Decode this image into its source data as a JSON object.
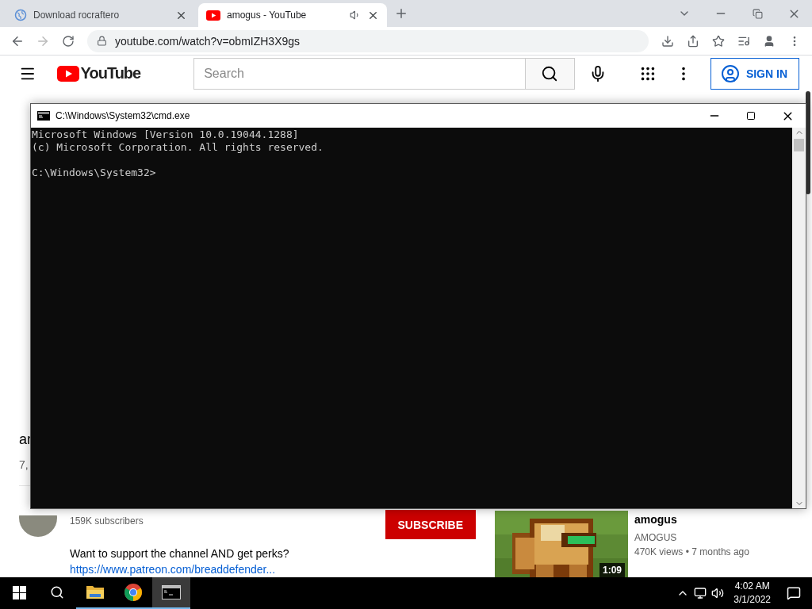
{
  "browser": {
    "tabs": [
      {
        "title": "Download rocraftero",
        "selected": false,
        "audio": false
      },
      {
        "title": "amogus - YouTube",
        "selected": true,
        "audio": true
      }
    ],
    "url": "youtube.com/watch?v=obmIZH3X9gs"
  },
  "youtube": {
    "logo": "YouTube",
    "search": {
      "placeholder": "Search"
    },
    "sign_in": "SIGN IN",
    "video_title": "ar",
    "video_views": "7,",
    "subscribers": "159K subscribers",
    "subscribe": "SUBSCRIBE",
    "description": "Want to support the channel AND get perks?",
    "link": "https://www.patreon.com/breaddefender...",
    "related": [
      {
        "kind": "picture",
        "title": "amogus",
        "channel": "AMOGUS",
        "meta": "470K views • 7 months ago",
        "duration": "1:09"
      }
    ]
  },
  "console": {
    "title": "C:\\Windows\\System32\\cmd.exe",
    "lines": [
      "Microsoft Windows [Version 10.0.19044.1288]",
      "(c) Microsoft Corporation. All rights reserved."
    ],
    "prompt": "C:\\Windows\\System32>"
  },
  "taskbar": {
    "apps": [
      {
        "kind": "explorer",
        "selected": false
      },
      {
        "kind": "chrome",
        "selected": false
      },
      {
        "kind": "console",
        "selected": true
      }
    ],
    "time": "4:02 AM",
    "date": "3/1/2022"
  }
}
